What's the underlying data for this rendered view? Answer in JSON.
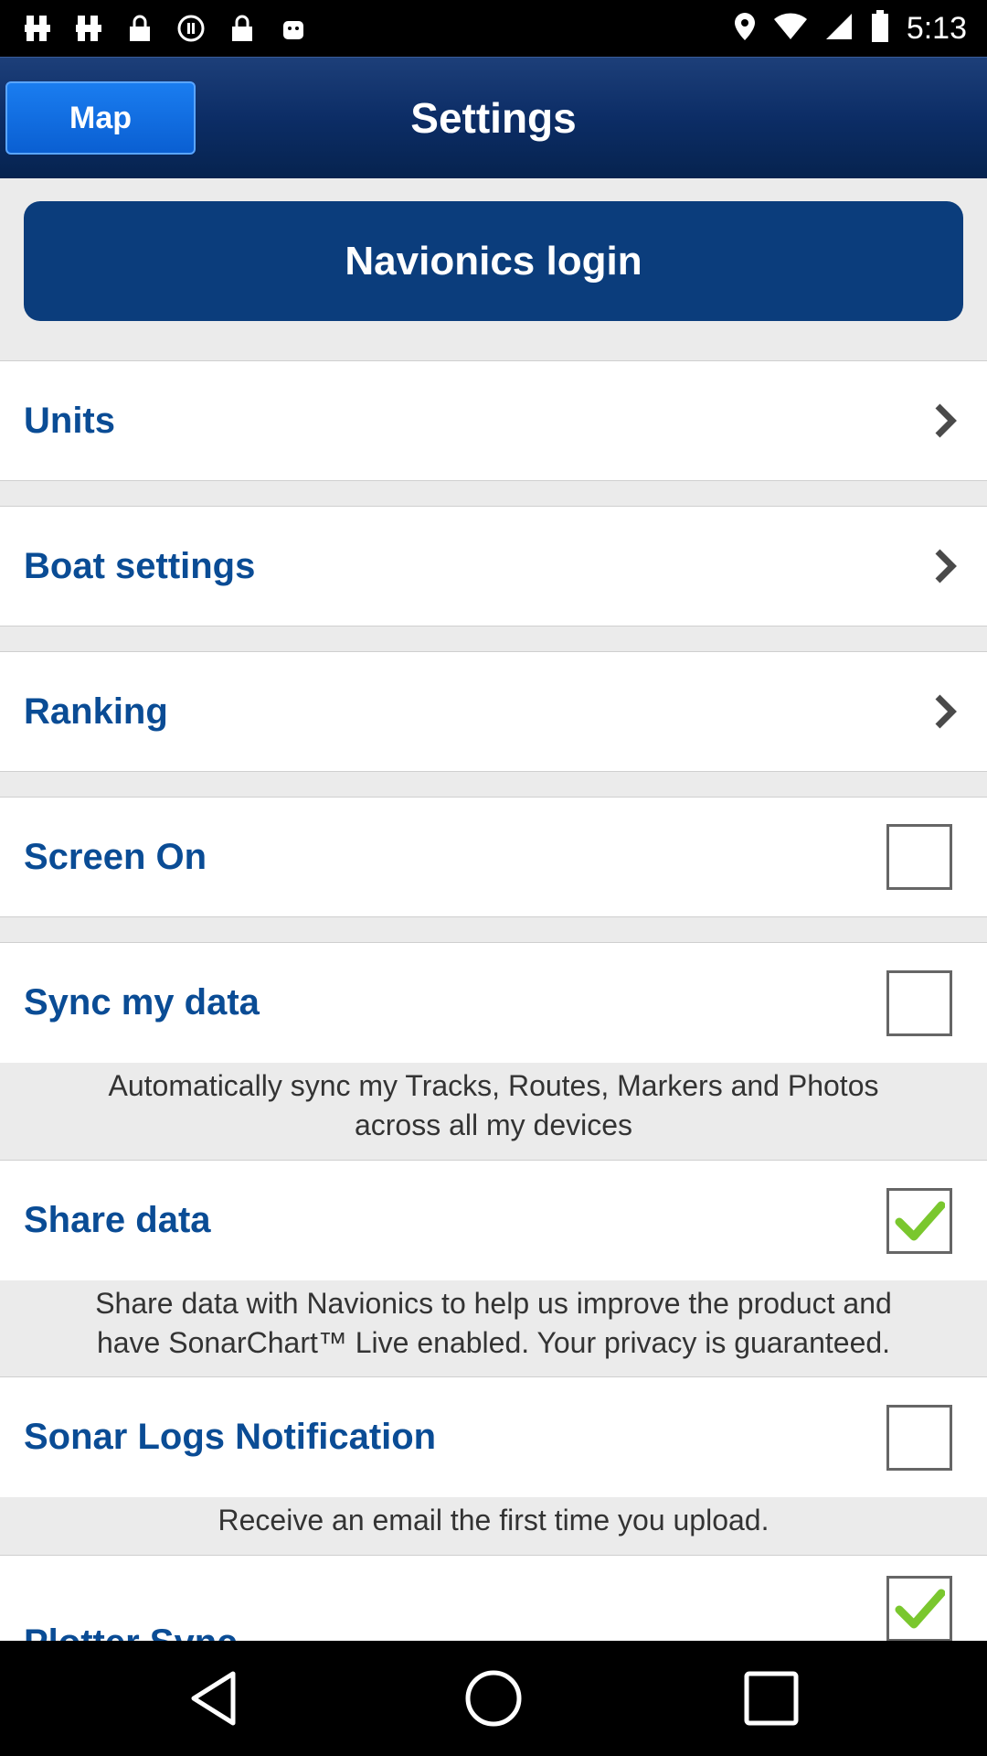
{
  "status_bar": {
    "time": "5:13",
    "icons": [
      "notification-icon",
      "notification-icon",
      "lock-icon",
      "stop-icon",
      "lock-icon",
      "android-icon",
      "location-icon",
      "wifi-icon",
      "signal-icon",
      "battery-icon"
    ]
  },
  "header": {
    "map_button": "Map",
    "title": "Settings"
  },
  "login_button": "Navionics login",
  "rows": {
    "units": "Units",
    "boat_settings": "Boat settings",
    "ranking": "Ranking",
    "screen_on": {
      "label": "Screen On",
      "checked": false
    },
    "sync_my_data": {
      "label": "Sync my data",
      "checked": false,
      "description_line1": "Automatically sync my Tracks, Routes, Markers and Photos",
      "description_line2": "across all my devices"
    },
    "share_data": {
      "label": "Share data",
      "checked": true,
      "description_line1": "Share data with Navionics to help us improve the product and",
      "description_line2": "have SonarChart™ Live enabled. Your privacy is guaranteed."
    },
    "sonar_logs": {
      "label": "Sonar Logs Notification",
      "checked": false,
      "description": "Receive an email the first time you upload."
    },
    "plotter_sync": {
      "label": "Plotter Sync",
      "checked": true
    }
  },
  "colors": {
    "accent": "#0a4c95",
    "header": "#0c2d66",
    "map_button": "#0a6fe5",
    "check": "#7ac72e"
  }
}
